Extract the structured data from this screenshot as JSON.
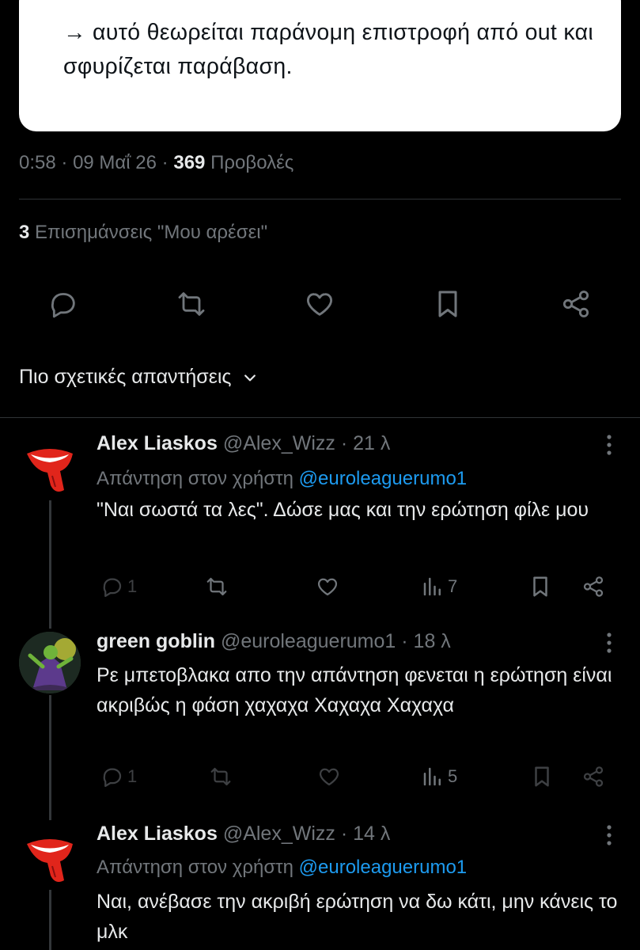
{
  "tweet": {
    "quote_text": "→ αυτό θεωρείται παράνομη επιστροφή από out και σφυρίζεται παράβαση.",
    "time": "0:58",
    "date": "09 Μαΐ 26",
    "views_count": "369",
    "views_label": "Προβολές",
    "likes_count": "3",
    "likes_label": "Επισημάνσεις \"Μου αρέσει\"",
    "sort_label": "Πιο σχετικές απαντήσεις"
  },
  "replies": [
    {
      "name": "Alex Liaskos",
      "handle": "@Alex_Wizz",
      "time": "21 λ",
      "reply_prefix": "Απάντηση στον χρήστη",
      "reply_to": "@euroleaguerumo1",
      "text": "\"Ναι σωστά τα λες\". Δώσε μας και την ερώτηση φίλε μου",
      "replies_count": "1",
      "views_count": "7"
    },
    {
      "name": "green goblin",
      "handle": "@euroleaguerumo1",
      "time": "18 λ",
      "text": "Ρε μπετοβλακα απο την απάντηση φενεται η ερώτηση είναι ακριβώς η φάση χαχαχα Χαχαχα Χαχαχα",
      "replies_count": "1",
      "views_count": "5"
    },
    {
      "name": "Alex Liaskos",
      "handle": "@Alex_Wizz",
      "time": "14 λ",
      "reply_prefix": "Απάντηση στον χρήστη",
      "reply_to": "@euroleaguerumo1",
      "text": "Ναι, ανέβασε την ακριβή ερώτηση να δω κάτι, μην κάνεις το μλκ"
    }
  ],
  "separator": "·",
  "colors": {
    "background": "#000000",
    "text": "#e7e9ea",
    "muted": "#71767b",
    "accent": "#1d9bf0",
    "card": "#ffffff"
  }
}
